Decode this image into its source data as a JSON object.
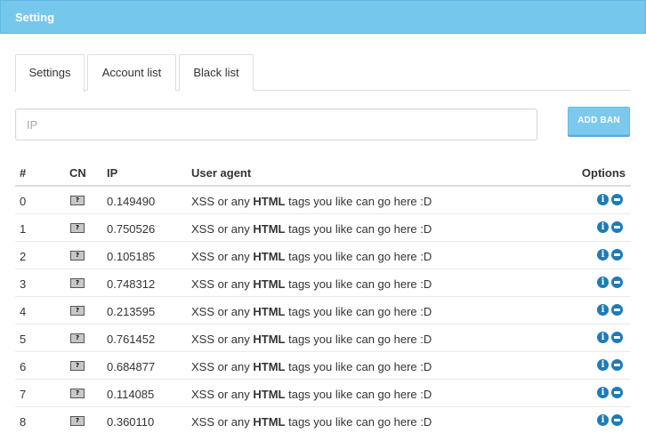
{
  "header": {
    "title": "Setting"
  },
  "tabs": [
    {
      "label": "Settings"
    },
    {
      "label": "Account list"
    },
    {
      "label": "Black list"
    }
  ],
  "ban_form": {
    "placeholder": "IP",
    "button_label": "ADD BAN"
  },
  "table": {
    "columns": [
      "#",
      "CN",
      "IP",
      "User agent",
      "Options"
    ],
    "flag_glyph": "?",
    "ua_parts": {
      "before": "XSS or any ",
      "bold": "HTML",
      "after": " tags you like can go here :D"
    },
    "rows": [
      {
        "num": "0",
        "ip": "0.149490"
      },
      {
        "num": "1",
        "ip": "0.750526"
      },
      {
        "num": "2",
        "ip": "0.105185"
      },
      {
        "num": "3",
        "ip": "0.748312"
      },
      {
        "num": "4",
        "ip": "0.213595"
      },
      {
        "num": "5",
        "ip": "0.761452"
      },
      {
        "num": "6",
        "ip": "0.684877"
      },
      {
        "num": "7",
        "ip": "0.114085"
      },
      {
        "num": "8",
        "ip": "0.360110"
      }
    ]
  },
  "icons": {
    "info": "info-icon",
    "remove": "remove-icon",
    "flag": "unknown-flag-icon"
  },
  "colors": {
    "header_bg": "#76c7ec",
    "button_bg": "#7cc9ee",
    "icon_blue": "#1d7bb8"
  }
}
